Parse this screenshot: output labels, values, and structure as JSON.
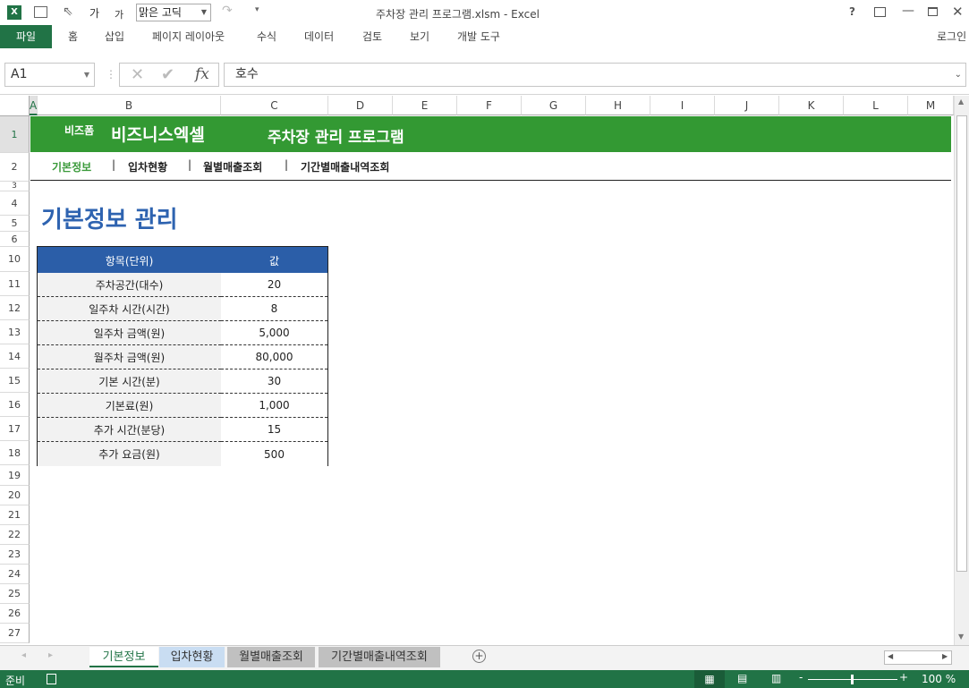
{
  "window": {
    "title": "주차장 관리 프로그램.xlsm - Excel",
    "font_name": "맑은 고딕",
    "help": "?",
    "login": "로그인"
  },
  "ribbon": {
    "tabs": [
      "파일",
      "홈",
      "삽입",
      "페이지 레이아웃",
      "수식",
      "데이터",
      "검토",
      "보기",
      "개발 도구"
    ]
  },
  "formula_bar": {
    "name_box": "A1",
    "formula": "호수",
    "fx": "fx"
  },
  "columns": [
    "A",
    "B",
    "C",
    "D",
    "E",
    "F",
    "G",
    "H",
    "I",
    "J",
    "K",
    "L",
    "M"
  ],
  "rows": [
    "1",
    "2",
    "3",
    "4",
    "5",
    "6",
    "10",
    "11",
    "12",
    "13",
    "14",
    "15",
    "16",
    "17",
    "18",
    "19",
    "20",
    "21",
    "22",
    "23",
    "24",
    "25",
    "26",
    "27"
  ],
  "banner": {
    "brand_small": "비즈폼",
    "brand": "비즈니스엑셀",
    "title": "주차장 관리 프로그램"
  },
  "nav": {
    "items": [
      "기본정보",
      "입차현황",
      "월별매출조회",
      "기간별매출내역조회"
    ],
    "separator": "|"
  },
  "page_heading": "기본정보 관리",
  "table": {
    "headers": [
      "항목(단위)",
      "값"
    ],
    "rows": [
      [
        "주차공간(대수)",
        "20"
      ],
      [
        "일주차 시간(시간)",
        "8"
      ],
      [
        "일주차 금액(원)",
        "5,000"
      ],
      [
        "월주차 금액(원)",
        "80,000"
      ],
      [
        "기본 시간(분)",
        "30"
      ],
      [
        "기본료(원)",
        "1,000"
      ],
      [
        "추가 시간(분당)",
        "15"
      ],
      [
        "추가 요금(원)",
        "500"
      ]
    ]
  },
  "sheet_tabs": [
    {
      "label": "기본정보",
      "active": true
    },
    {
      "label": "입차현황"
    },
    {
      "label": "월별매출조회"
    },
    {
      "label": "기간별매출내역조회"
    }
  ],
  "status": {
    "ready": "준비",
    "zoom": "100 %"
  },
  "colors": {
    "excel_green": "#217346",
    "banner_green": "#339933",
    "table_header": "#2b5ea8",
    "heading_blue": "#2e63b0"
  }
}
